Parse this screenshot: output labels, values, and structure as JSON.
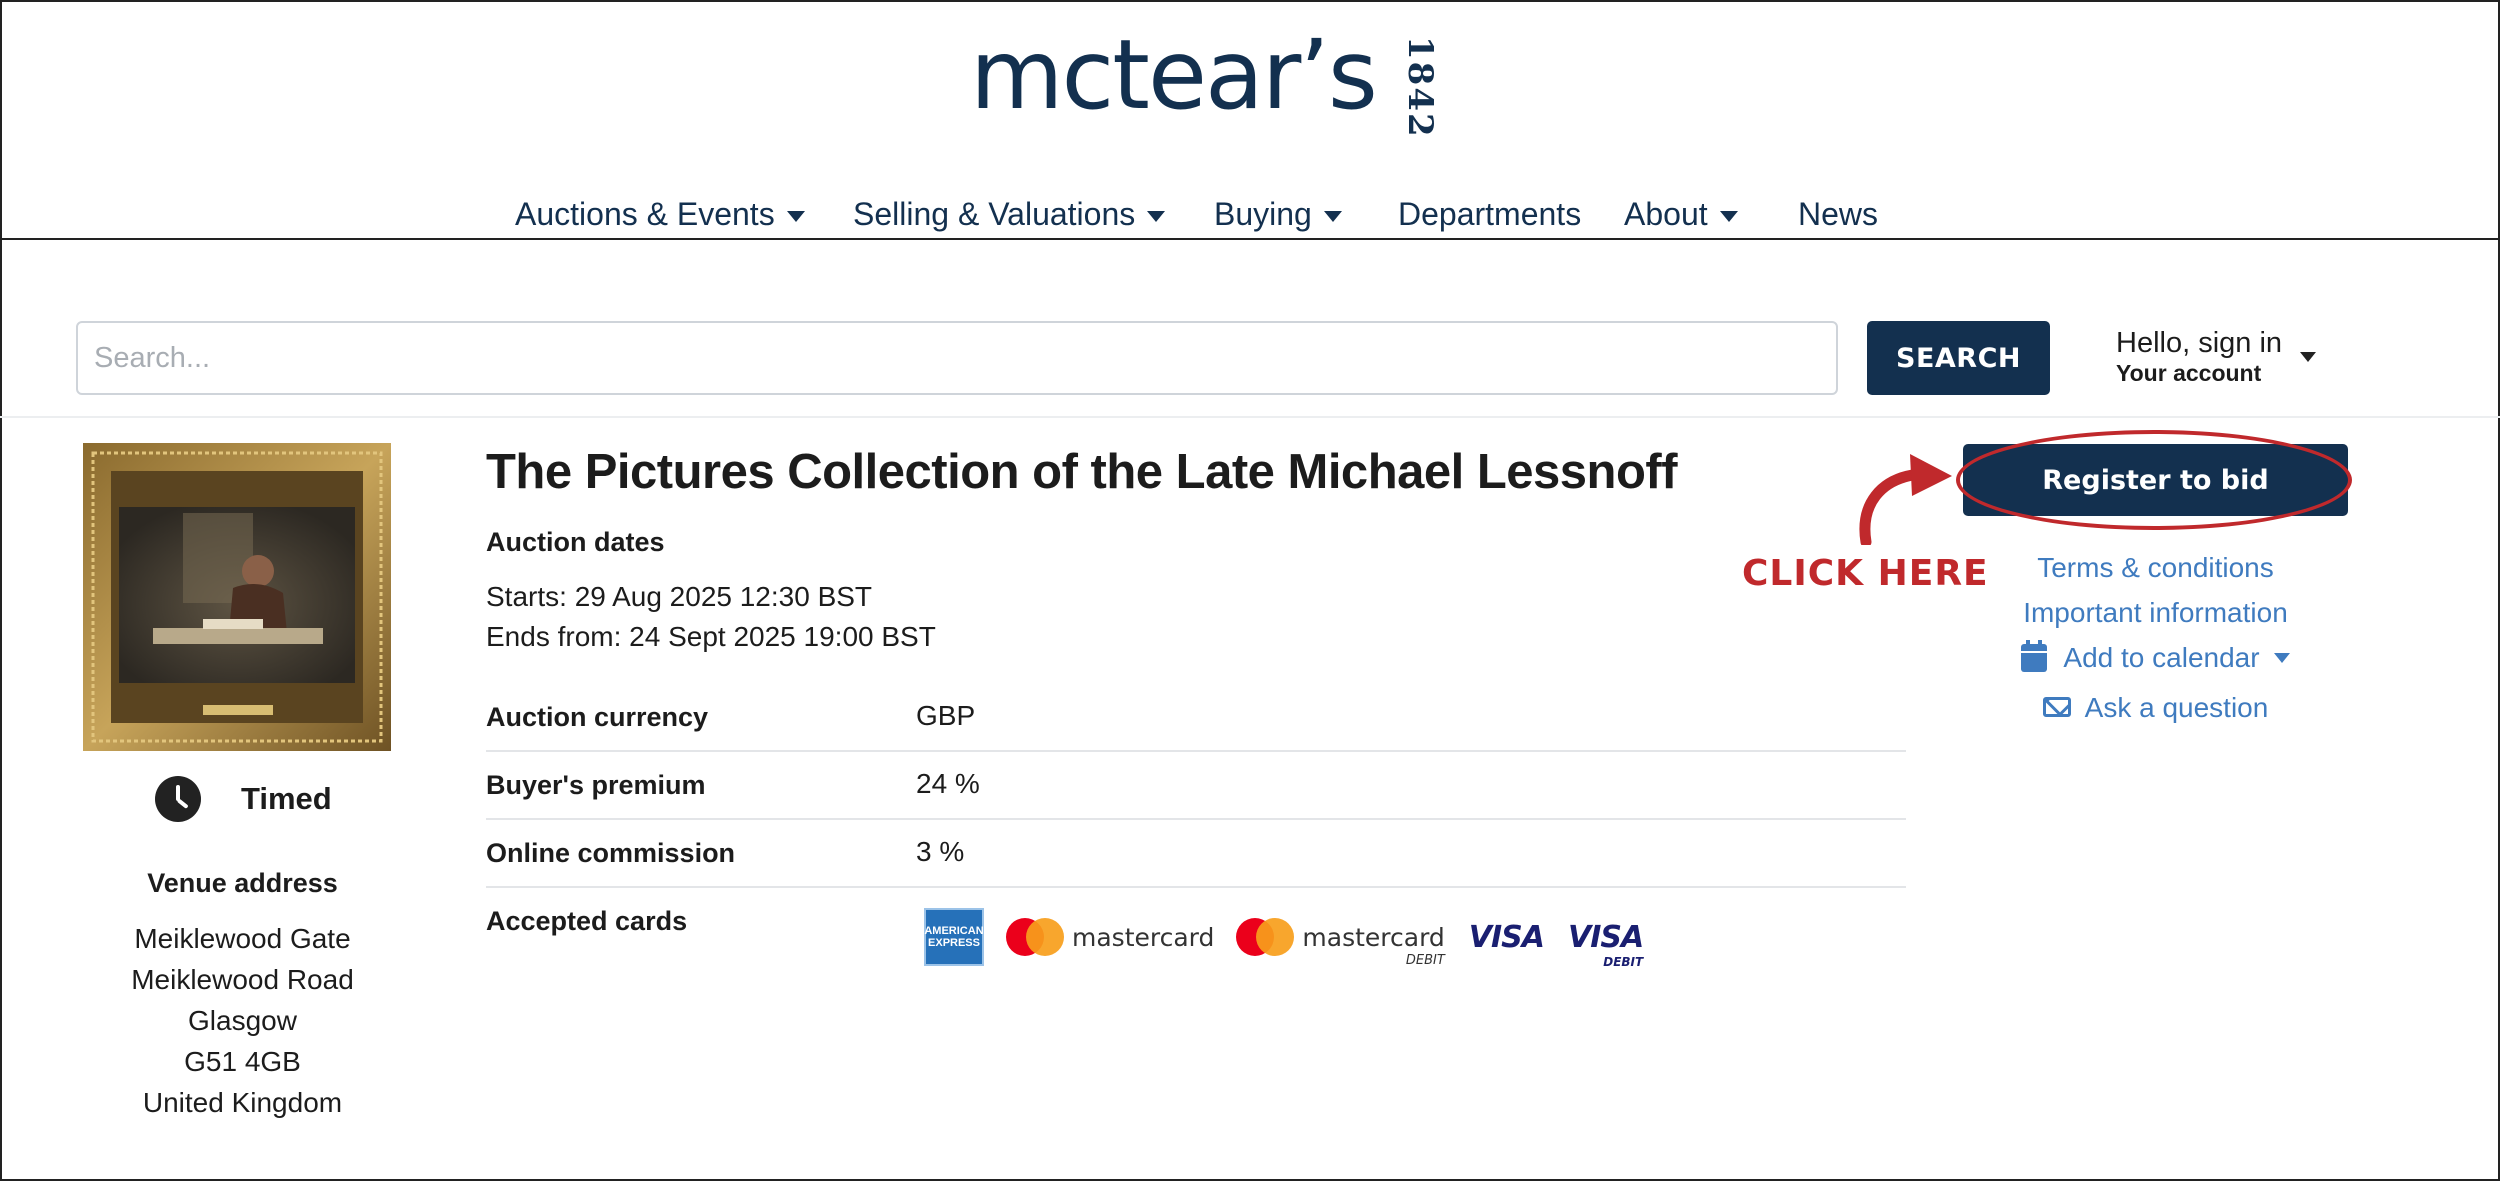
{
  "header": {
    "logo_word": "mctear’s",
    "logo_year": "1842",
    "nav": [
      {
        "label": "Auctions & Events",
        "has_dropdown": true
      },
      {
        "label": "Selling & Valuations",
        "has_dropdown": true
      },
      {
        "label": "Buying",
        "has_dropdown": true
      },
      {
        "label": "Departments",
        "has_dropdown": false
      },
      {
        "label": "About",
        "has_dropdown": true
      },
      {
        "label": "News",
        "has_dropdown": false
      }
    ]
  },
  "search": {
    "placeholder": "Search...",
    "value": "",
    "button_label": "SEARCH"
  },
  "account": {
    "hello": "Hello, sign in",
    "your_account": "Your account"
  },
  "auction": {
    "title": "The Pictures Collection of the Late Michael Lessnoff",
    "type_label": "Timed",
    "dates_label": "Auction dates",
    "starts": "Starts: 29 Aug 2025 12:30 BST",
    "ends": "Ends from: 24 Sept 2025 19:00 BST",
    "details": [
      {
        "key": "Auction currency",
        "value": "GBP"
      },
      {
        "key": "Buyer's premium",
        "value": "24 %"
      },
      {
        "key": "Online commission",
        "value": "3 %"
      }
    ],
    "accepted_cards_label": "Accepted cards",
    "cards": {
      "amex": "AMERICAN EXPRESS",
      "mastercard": "mastercard",
      "mastercard_debit": "mastercard",
      "debit_tag": "DEBIT",
      "visa": "VISA",
      "visa_debit": "VISA",
      "visa_debit_tag": "DEBIT"
    }
  },
  "venue": {
    "title": "Venue address",
    "lines": [
      "Meiklewood Gate",
      "Meiklewood Road",
      "Glasgow",
      "G51 4GB",
      "United Kingdom"
    ]
  },
  "actions": {
    "register_label": "Register to bid",
    "annotation": "CLICK HERE",
    "terms": "Terms & conditions",
    "important": "Important information",
    "calendar": "Add to calendar",
    "ask": "Ask a question"
  },
  "colors": {
    "brand_navy": "#13304f",
    "link_blue": "#3f7bbf",
    "annotation_red": "#c0292c"
  }
}
